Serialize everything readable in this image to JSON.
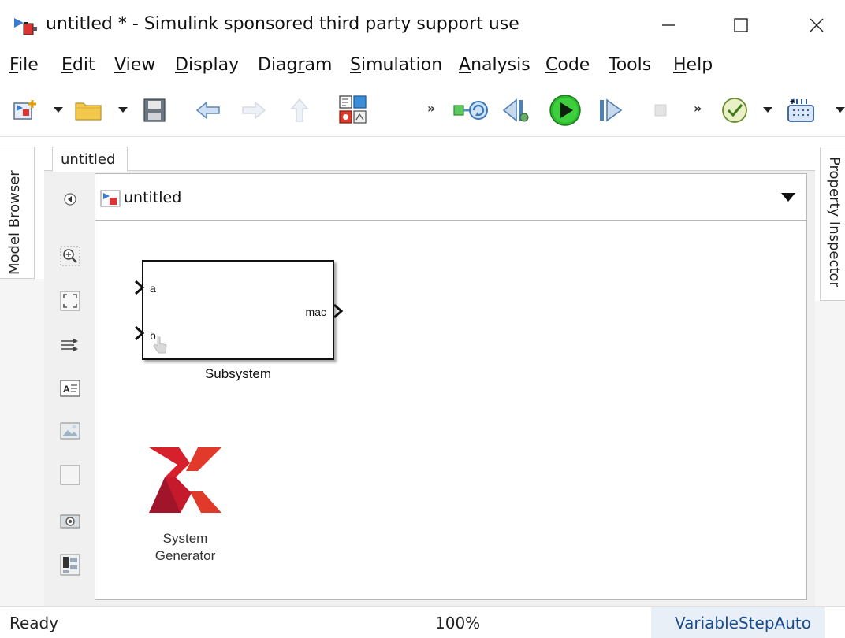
{
  "window": {
    "title": "untitled * - Simulink sponsored third party support use",
    "app_icon": "simulink-model-icon",
    "controls": {
      "minimize": "minimize-icon",
      "maximize": "maximize-icon",
      "close": "close-icon"
    }
  },
  "menu": {
    "items": [
      {
        "pre": "",
        "key": "F",
        "post": "ile"
      },
      {
        "pre": "",
        "key": "E",
        "post": "dit"
      },
      {
        "pre": "",
        "key": "V",
        "post": "iew"
      },
      {
        "pre": "",
        "key": "D",
        "post": "isplay"
      },
      {
        "pre": "Diag",
        "key": "r",
        "post": "am"
      },
      {
        "pre": "",
        "key": "S",
        "post": "imulation"
      },
      {
        "pre": "",
        "key": "A",
        "post": "nalysis"
      },
      {
        "pre": "",
        "key": "C",
        "post": "ode"
      },
      {
        "pre": "",
        "key": "T",
        "post": "ools"
      },
      {
        "pre": "",
        "key": "H",
        "post": "elp"
      }
    ]
  },
  "toolbar": {
    "icons": [
      "new-model-icon",
      "open-folder-icon",
      "save-icon",
      "back-arrow-icon",
      "forward-arrow-icon",
      "up-arrow-icon",
      "library-browser-icon",
      "more-icon",
      "update-diagram-icon",
      "step-back-icon",
      "run-icon",
      "step-forward-icon",
      "stop-icon",
      "more-icon",
      "model-advisor-icon",
      "build-icon"
    ],
    "more_glyph": "»"
  },
  "side_tabs": {
    "left": "Model Browser",
    "right": "Property Inspector"
  },
  "editor": {
    "tab_label": "untitled",
    "address": "untitled",
    "palette_icons": [
      "hide-browser-icon",
      "zoom-icon",
      "fit-to-view-icon",
      "route-lines-icon",
      "annotation-icon",
      "image-icon",
      "area-icon",
      "screenshot-icon",
      "viewmarks-icon"
    ]
  },
  "canvas": {
    "subsystem": {
      "name": "Subsystem",
      "inputs": [
        "a",
        "b"
      ],
      "outputs": [
        "mac"
      ]
    },
    "sysgen": {
      "name_line1": "System",
      "name_line2": "Generator",
      "logo": "xilinx-logo-icon"
    }
  },
  "statusbar": {
    "status": "Ready",
    "zoom": "100%",
    "solver": "VariableStepAuto"
  },
  "colors": {
    "run_green": "#2eb82e",
    "xilinx_red": "#d6202b",
    "xilinx_dark": "#a0152a",
    "solver_text": "#1a4b8c"
  }
}
